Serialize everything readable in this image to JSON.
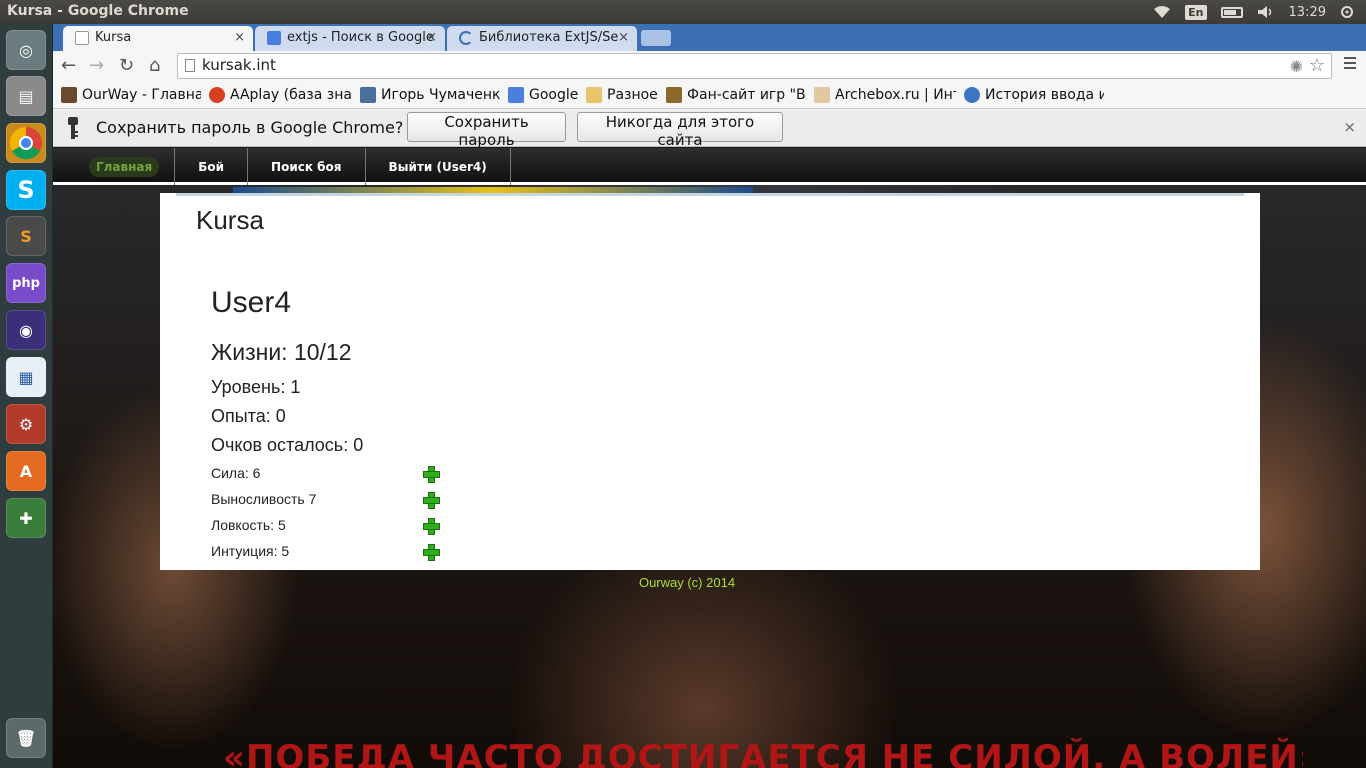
{
  "os_panel": {
    "window_title": "Kursa - Google Chrome",
    "keyboard_lang": "En",
    "clock": "13:29"
  },
  "launcher": {
    "items": [
      "ubuntu-dash-icon",
      "files-icon",
      "chrome-icon",
      "skype-icon",
      "sublime-text-icon",
      "phpstorm-icon",
      "eclipse-icon",
      "libreoffice-writer-icon",
      "system-settings-icon",
      "software-center-icon",
      "playonlinux-icon",
      "trash-icon"
    ]
  },
  "browser": {
    "tabs": [
      {
        "label": "Kursa",
        "close": "×"
      },
      {
        "label": "extjs - Поиск в Google",
        "close": "×"
      },
      {
        "label": "Библиотека ExtJS/Se",
        "close": "×"
      }
    ],
    "url": "kursak.int",
    "bookmarks": [
      "OurWay - Главна",
      "AAplay (база знан",
      "Игорь Чумаченко",
      "Google",
      "Разное",
      "Фан-сайт игр \"Вой",
      "Archebox.ru | Инте",
      "История ввода и в"
    ],
    "infobar": {
      "message": "Сохранить пароль в Google Chrome?",
      "save_label": "Сохранить пароль",
      "never_label": "Никогда для этого сайта",
      "close": "×"
    }
  },
  "site": {
    "nav": {
      "home": "Главная",
      "fight": "Бой",
      "find_fight": "Поиск боя",
      "logout": "Выйти (User4)"
    },
    "title": "Kursa",
    "user_name": "User4",
    "hp": "Жизни: 10/12",
    "level": "Уровень: 1",
    "experience": "Опыта: 0",
    "points_left": "Очков осталось: 0",
    "attributes": [
      {
        "label": "Сила: 6"
      },
      {
        "label": "Выносливость 7"
      },
      {
        "label": "Ловкость: 5"
      },
      {
        "label": "Интуиция: 5"
      }
    ],
    "footer": "Ourway (c) 2014",
    "banner_slogan": "«ПОБЕДА ЧАСТО ДОСТИГАЕТСЯ НЕ СИЛОЙ, А ВОЛЕЙ» (СПАРТАК)"
  }
}
